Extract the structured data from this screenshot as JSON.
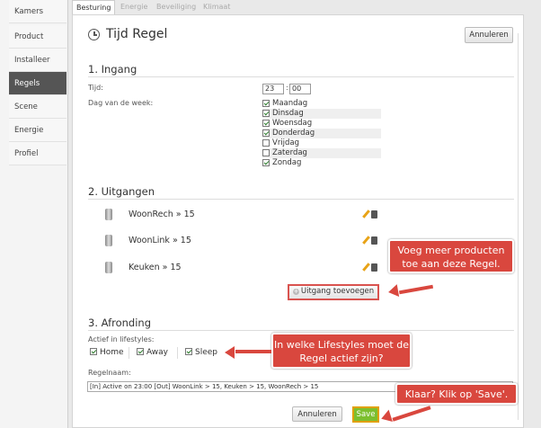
{
  "sidebar": {
    "items": [
      {
        "label": "Kamers",
        "active": false
      },
      {
        "label": "Product",
        "active": false
      },
      {
        "label": "Installeer",
        "active": false
      },
      {
        "label": "Regels",
        "active": true
      },
      {
        "label": "Scene",
        "active": false
      },
      {
        "label": "Energie",
        "active": false
      },
      {
        "label": "Profiel",
        "active": false
      }
    ]
  },
  "tabs": [
    {
      "label": "Besturing",
      "active": true
    },
    {
      "label": "Energie",
      "active": false
    },
    {
      "label": "Beveiliging",
      "active": false
    },
    {
      "label": "Klimaat",
      "active": false
    }
  ],
  "header": {
    "title": "Tijd Regel",
    "cancel_label": "Annuleren",
    "icon": "clock-icon"
  },
  "ingang": {
    "title": "1. Ingang",
    "time_label": "Tijd:",
    "hour": "23",
    "separator": ":",
    "minute": "00",
    "days_label": "Dag van de week:",
    "days": [
      {
        "label": "Maandag",
        "checked": true
      },
      {
        "label": "Dinsdag",
        "checked": true
      },
      {
        "label": "Woensdag",
        "checked": true
      },
      {
        "label": "Donderdag",
        "checked": true
      },
      {
        "label": "Vrijdag",
        "checked": false
      },
      {
        "label": "Zaterdag",
        "checked": false
      },
      {
        "label": "Zondag",
        "checked": true
      }
    ]
  },
  "uitgangen": {
    "title": "2. Uitgangen",
    "outputs": [
      {
        "label": "WoonRech » 15"
      },
      {
        "label": "WoonLink » 15"
      },
      {
        "label": "Keuken » 15"
      }
    ],
    "add_label": "Uitgang toevoegen"
  },
  "afronding": {
    "title": "3. Afronding",
    "lifestyles_label": "Actief in lifestyles:",
    "lifestyles": [
      {
        "label": "Home",
        "checked": true
      },
      {
        "label": "Away",
        "checked": true
      },
      {
        "label": "Sleep",
        "checked": true
      }
    ],
    "rule_name_label": "Regelnaam:",
    "rule_name_value": "[In] Active on 23:00  [Out] WoonLink > 15, Keuken > 15, WoonRech > 15",
    "cancel_label": "Annuleren",
    "save_label": "Save"
  },
  "callouts": {
    "products": "Voeg meer producten toe aan deze Regel.",
    "lifestyles": "In welke Lifestyles moet de Regel actief zijn?",
    "save": "Klaar? Klik op 'Save'."
  },
  "colors": {
    "accent_red": "#d9473e",
    "save_green": "#7cbf2e",
    "sidebar_active": "#555555"
  }
}
